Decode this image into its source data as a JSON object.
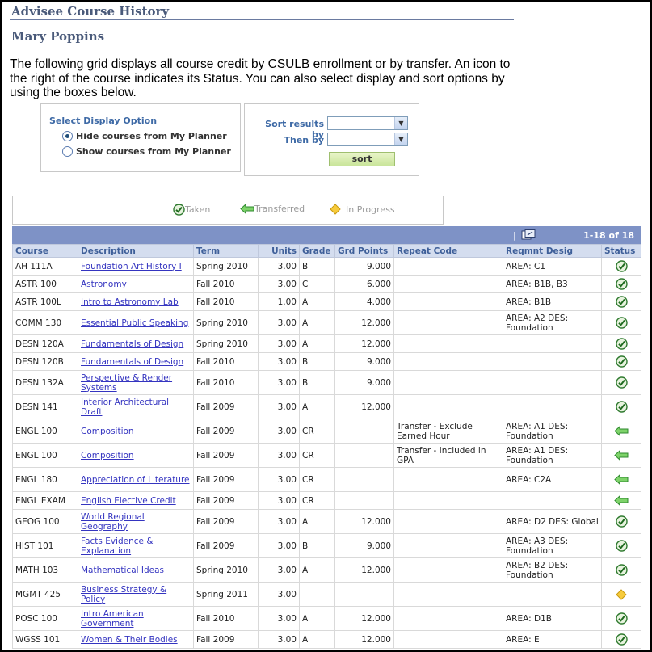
{
  "page": {
    "title": "Advisee Course History",
    "student_name": "Mary Poppins",
    "intro": "The following grid displays all course credit by CSULB enrollment or by transfer. An icon to the right of the course indicates its Status. You can also select display and sort options by using the boxes below."
  },
  "display_option": {
    "title": "Select Display Option",
    "options": [
      {
        "label": "Hide courses from My Planner",
        "checked": true
      },
      {
        "label": "Show courses from My Planner",
        "checked": false
      }
    ]
  },
  "sort": {
    "sort_by_label": "Sort results by",
    "then_by_label": "Then by",
    "sort_by_value": "",
    "then_by_value": "",
    "button_label": "sort"
  },
  "legend": {
    "taken": "Taken",
    "transferred": "Transferred",
    "in_progress": "In Progress"
  },
  "grid": {
    "count": "1-18 of 18",
    "columns": [
      "Course",
      "Description",
      "Term",
      "Units",
      "Grade",
      "Grd Points",
      "Repeat Code",
      "Reqmnt Desig",
      "Status"
    ],
    "rows": [
      {
        "course": "AH 111A",
        "description": "Foundation Art History I",
        "term": "Spring 2010",
        "units": "3.00",
        "grade": "B",
        "points": "9.000",
        "repeat": "",
        "reqmnt": "AREA: C1",
        "status": "taken"
      },
      {
        "course": "ASTR 100",
        "description": "Astronomy",
        "term": "Fall 2010",
        "units": "3.00",
        "grade": "C",
        "points": "6.000",
        "repeat": "",
        "reqmnt": "AREA: B1B, B3",
        "status": "taken"
      },
      {
        "course": "ASTR 100L",
        "description": "Intro to Astronomy Lab",
        "term": "Fall 2010",
        "units": "1.00",
        "grade": "A",
        "points": "4.000",
        "repeat": "",
        "reqmnt": "AREA: B1B",
        "status": "taken"
      },
      {
        "course": "COMM 130",
        "description": "Essential Public Speaking",
        "term": "Spring 2010",
        "units": "3.00",
        "grade": "A",
        "points": "12.000",
        "repeat": "",
        "reqmnt": "AREA: A2 DES: Foundation",
        "status": "taken"
      },
      {
        "course": "DESN 120A",
        "description": "Fundamentals of Design",
        "term": "Spring 2010",
        "units": "3.00",
        "grade": "A",
        "points": "12.000",
        "repeat": "",
        "reqmnt": "",
        "status": "taken"
      },
      {
        "course": "DESN 120B",
        "description": "Fundamentals of Design",
        "term": "Fall 2010",
        "units": "3.00",
        "grade": "B",
        "points": "9.000",
        "repeat": "",
        "reqmnt": "",
        "status": "taken"
      },
      {
        "course": "DESN 132A",
        "description": "Perspective & Render Systems",
        "term": "Fall 2010",
        "units": "3.00",
        "grade": "B",
        "points": "9.000",
        "repeat": "",
        "reqmnt": "",
        "status": "taken"
      },
      {
        "course": "DESN 141",
        "description": "Interior Architectural Draft",
        "term": "Fall 2009",
        "units": "3.00",
        "grade": "A",
        "points": "12.000",
        "repeat": "",
        "reqmnt": "",
        "status": "taken"
      },
      {
        "course": "ENGL 100",
        "description": "Composition",
        "term": "Fall 2009",
        "units": "3.00",
        "grade": "CR",
        "points": "",
        "repeat": "Transfer - Exclude Earned Hour",
        "reqmnt": "AREA: A1 DES: Foundation",
        "status": "transferred"
      },
      {
        "course": "ENGL 100",
        "description": "Composition",
        "term": "Fall 2009",
        "units": "3.00",
        "grade": "CR",
        "points": "",
        "repeat": "Transfer - Included in GPA",
        "reqmnt": "AREA: A1 DES: Foundation",
        "status": "transferred"
      },
      {
        "course": "ENGL 180",
        "description": "Appreciation of Literature",
        "term": "Fall 2009",
        "units": "3.00",
        "grade": "CR",
        "points": "",
        "repeat": "",
        "reqmnt": "AREA: C2A",
        "status": "transferred"
      },
      {
        "course": "ENGL EXAM",
        "description": "English Elective Credit",
        "term": "Fall 2009",
        "units": "3.00",
        "grade": "CR",
        "points": "",
        "repeat": "",
        "reqmnt": "",
        "status": "transferred"
      },
      {
        "course": "GEOG 100",
        "description": "World Regional Geography",
        "term": "Fall 2009",
        "units": "3.00",
        "grade": "A",
        "points": "12.000",
        "repeat": "",
        "reqmnt": "AREA: D2 DES: Global",
        "status": "taken"
      },
      {
        "course": "HIST 101",
        "description": "Facts Evidence & Explanation",
        "term": "Fall 2009",
        "units": "3.00",
        "grade": "B",
        "points": "9.000",
        "repeat": "",
        "reqmnt": "AREA: A3 DES: Foundation",
        "status": "taken"
      },
      {
        "course": "MATH 103",
        "description": "Mathematical Ideas",
        "term": "Spring 2010",
        "units": "3.00",
        "grade": "A",
        "points": "12.000",
        "repeat": "",
        "reqmnt": "AREA: B2 DES: Foundation",
        "status": "taken"
      },
      {
        "course": "MGMT 425",
        "description": "Business Strategy & Policy",
        "term": "Spring 2011",
        "units": "3.00",
        "grade": "",
        "points": "",
        "repeat": "",
        "reqmnt": "",
        "status": "in_progress"
      },
      {
        "course": "POSC 100",
        "description": "Intro American Government",
        "term": "Fall 2010",
        "units": "3.00",
        "grade": "A",
        "points": "12.000",
        "repeat": "",
        "reqmnt": "AREA: D1B",
        "status": "taken"
      },
      {
        "course": "WGSS 101",
        "description": "Women & Their Bodies",
        "term": "Fall 2009",
        "units": "3.00",
        "grade": "A",
        "points": "12.000",
        "repeat": "",
        "reqmnt": "AREA: E",
        "status": "taken"
      }
    ]
  },
  "colors": {
    "title": "#4a5a7a",
    "grid_header": "#7e92c6",
    "column_header_bg": "#d4ddef",
    "link": "#3434c0",
    "taken_icon": "#2f8a2f",
    "transferred_icon": "#3fa83f",
    "in_progress_icon": "#f2c12e"
  }
}
